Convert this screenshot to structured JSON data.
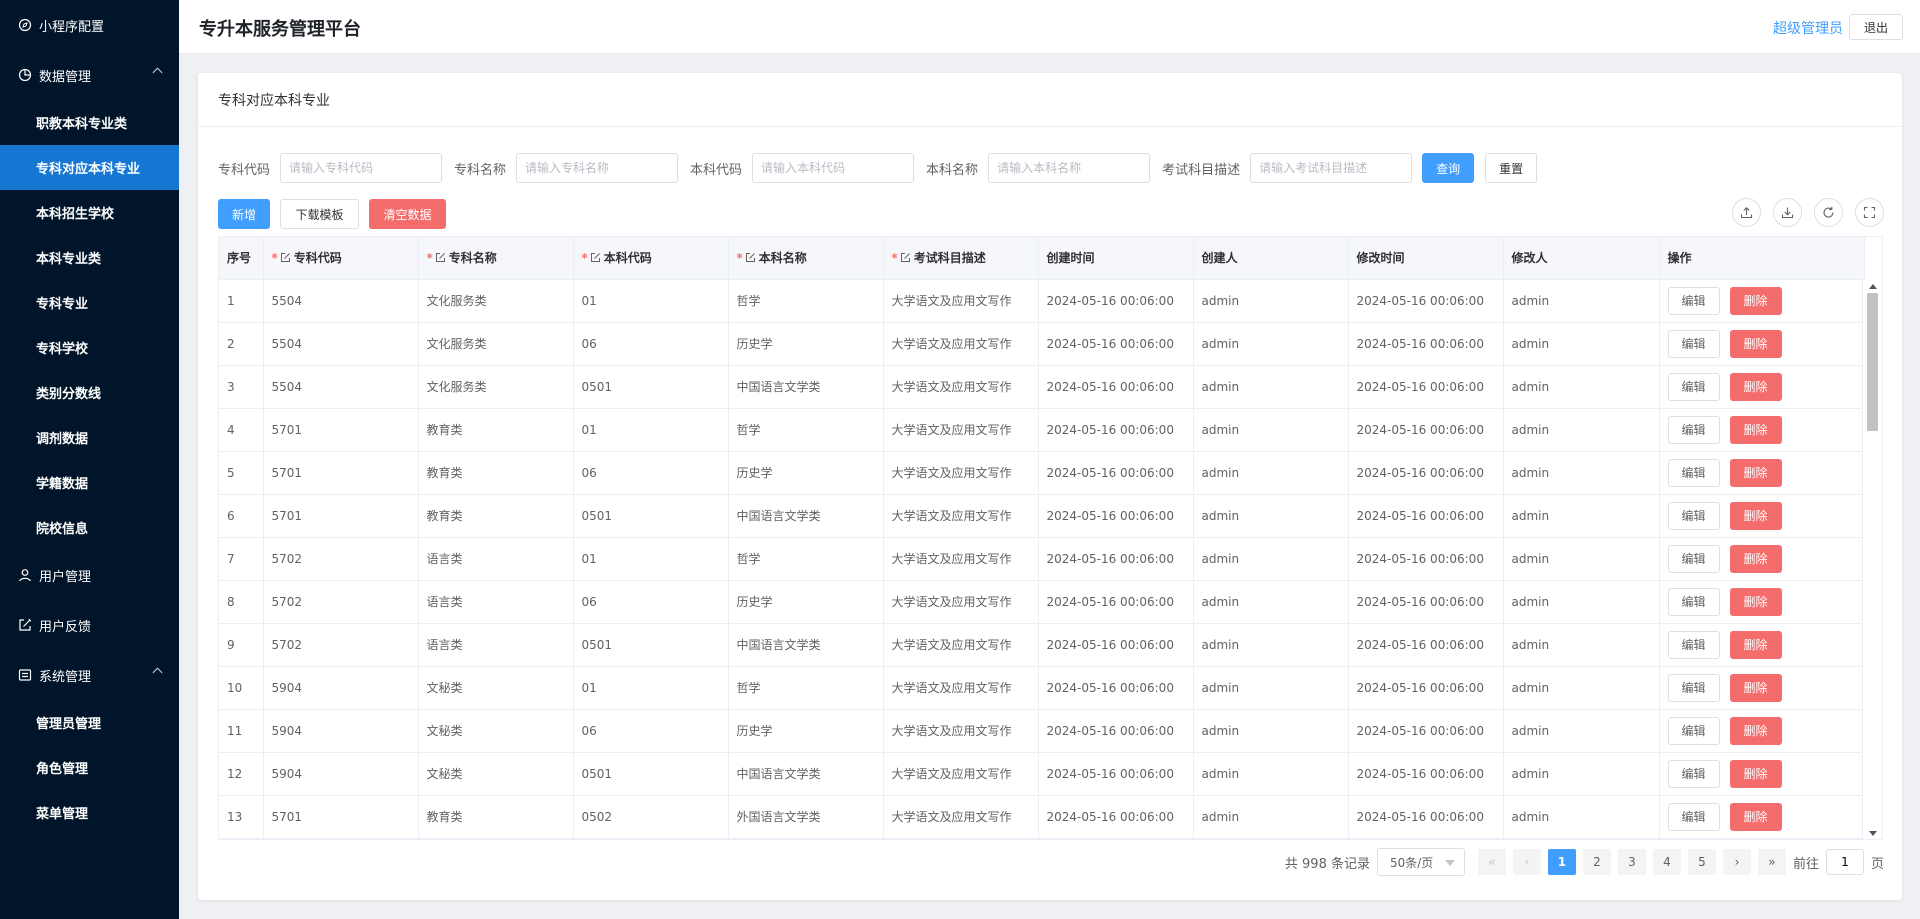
{
  "sidebar": {
    "top_item": "小程序配置",
    "groups": [
      {
        "label": "数据管理",
        "items": [
          "职教本科专业类",
          "专科对应本科专业",
          "本科招生学校",
          "本科专业类",
          "专科专业",
          "专科学校",
          "类别分数线",
          "调剂数据",
          "学籍数据",
          "院校信息"
        ]
      },
      {
        "label": "用户管理"
      },
      {
        "label": "用户反馈"
      },
      {
        "label": "系统管理",
        "items": [
          "管理员管理",
          "角色管理",
          "菜单管理"
        ]
      }
    ],
    "active_item": "专科对应本科专业"
  },
  "header": {
    "title": "专升本服务管理平台",
    "user": "超级管理员",
    "logout": "退出"
  },
  "card": {
    "title": "专科对应本科专业"
  },
  "filters": [
    {
      "label": "专科代码",
      "placeholder": "请输入专科代码"
    },
    {
      "label": "专科名称",
      "placeholder": "请输入专科名称"
    },
    {
      "label": "本科代码",
      "placeholder": "请输入本科代码"
    },
    {
      "label": "本科名称",
      "placeholder": "请输入本科名称"
    },
    {
      "label": "考试科目描述",
      "placeholder": "请输入考试科目描述"
    }
  ],
  "buttons": {
    "search": "查询",
    "reset": "重置",
    "add": "新增",
    "download": "下载模板",
    "clear": "清空数据"
  },
  "table": {
    "columns": [
      "序号",
      "专科代码",
      "专科名称",
      "本科代码",
      "本科名称",
      "考试科目描述",
      "创建时间",
      "创建人",
      "修改时间",
      "修改人",
      "操作"
    ],
    "rows": [
      [
        "1",
        "5504",
        "文化服务类",
        "01",
        "哲学",
        "大学语文及应用文写作",
        "2024-05-16 00:06:00",
        "admin",
        "2024-05-16 00:06:00",
        "admin"
      ],
      [
        "2",
        "5504",
        "文化服务类",
        "06",
        "历史学",
        "大学语文及应用文写作",
        "2024-05-16 00:06:00",
        "admin",
        "2024-05-16 00:06:00",
        "admin"
      ],
      [
        "3",
        "5504",
        "文化服务类",
        "0501",
        "中国语言文学类",
        "大学语文及应用文写作",
        "2024-05-16 00:06:00",
        "admin",
        "2024-05-16 00:06:00",
        "admin"
      ],
      [
        "4",
        "5701",
        "教育类",
        "01",
        "哲学",
        "大学语文及应用文写作",
        "2024-05-16 00:06:00",
        "admin",
        "2024-05-16 00:06:00",
        "admin"
      ],
      [
        "5",
        "5701",
        "教育类",
        "06",
        "历史学",
        "大学语文及应用文写作",
        "2024-05-16 00:06:00",
        "admin",
        "2024-05-16 00:06:00",
        "admin"
      ],
      [
        "6",
        "5701",
        "教育类",
        "0501",
        "中国语言文学类",
        "大学语文及应用文写作",
        "2024-05-16 00:06:00",
        "admin",
        "2024-05-16 00:06:00",
        "admin"
      ],
      [
        "7",
        "5702",
        "语言类",
        "01",
        "哲学",
        "大学语文及应用文写作",
        "2024-05-16 00:06:00",
        "admin",
        "2024-05-16 00:06:00",
        "admin"
      ],
      [
        "8",
        "5702",
        "语言类",
        "06",
        "历史学",
        "大学语文及应用文写作",
        "2024-05-16 00:06:00",
        "admin",
        "2024-05-16 00:06:00",
        "admin"
      ],
      [
        "9",
        "5702",
        "语言类",
        "0501",
        "中国语言文学类",
        "大学语文及应用文写作",
        "2024-05-16 00:06:00",
        "admin",
        "2024-05-16 00:06:00",
        "admin"
      ],
      [
        "10",
        "5904",
        "文秘类",
        "01",
        "哲学",
        "大学语文及应用文写作",
        "2024-05-16 00:06:00",
        "admin",
        "2024-05-16 00:06:00",
        "admin"
      ],
      [
        "11",
        "5904",
        "文秘类",
        "06",
        "历史学",
        "大学语文及应用文写作",
        "2024-05-16 00:06:00",
        "admin",
        "2024-05-16 00:06:00",
        "admin"
      ],
      [
        "12",
        "5904",
        "文秘类",
        "0501",
        "中国语言文学类",
        "大学语文及应用文写作",
        "2024-05-16 00:06:00",
        "admin",
        "2024-05-16 00:06:00",
        "admin"
      ],
      [
        "13",
        "5701",
        "教育类",
        "0502",
        "外国语言文学类",
        "大学语文及应用文写作",
        "2024-05-16 00:06:00",
        "admin",
        "2024-05-16 00:06:00",
        "admin"
      ]
    ],
    "row_actions": {
      "edit": "编辑",
      "delete": "删除"
    }
  },
  "pagination": {
    "total_text": "共 998 条记录",
    "page_size": "50条/页",
    "pages": [
      "1",
      "2",
      "3",
      "4",
      "5"
    ],
    "current": "1",
    "goto_label": "前往",
    "goto_value": "1",
    "goto_suffix": "页"
  },
  "colors": {
    "sidebar_bg": "#001529",
    "active": "#1677d3",
    "primary": "#409eff",
    "danger": "#f56c6c"
  }
}
